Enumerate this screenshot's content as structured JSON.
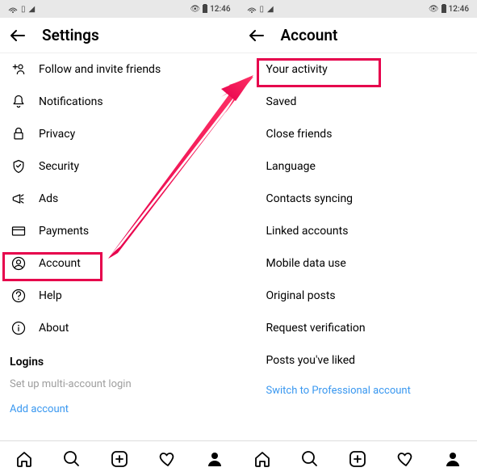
{
  "status": {
    "time": "12:46"
  },
  "left": {
    "title": "Settings",
    "items": [
      {
        "icon": "add-user-icon",
        "label": "Follow and invite friends"
      },
      {
        "icon": "bell-icon",
        "label": "Notifications"
      },
      {
        "icon": "lock-icon",
        "label": "Privacy"
      },
      {
        "icon": "shield-icon",
        "label": "Security"
      },
      {
        "icon": "megaphone-icon",
        "label": "Ads"
      },
      {
        "icon": "card-icon",
        "label": "Payments"
      },
      {
        "icon": "user-circle-icon",
        "label": "Account"
      },
      {
        "icon": "help-icon",
        "label": "Help"
      },
      {
        "icon": "info-icon",
        "label": "About"
      }
    ],
    "section_header": "Logins",
    "subtext": "Set up multi-account login",
    "link": "Add account"
  },
  "right": {
    "title": "Account",
    "items": [
      {
        "label": "Your activity"
      },
      {
        "label": "Saved"
      },
      {
        "label": "Close friends"
      },
      {
        "label": "Language"
      },
      {
        "label": "Contacts syncing"
      },
      {
        "label": "Linked accounts"
      },
      {
        "label": "Mobile data use"
      },
      {
        "label": "Original posts"
      },
      {
        "label": "Request verification"
      },
      {
        "label": "Posts you've liked"
      }
    ],
    "link": "Switch to Professional account"
  },
  "colors": {
    "highlight": "#e6004c",
    "link": "#3897f0"
  }
}
